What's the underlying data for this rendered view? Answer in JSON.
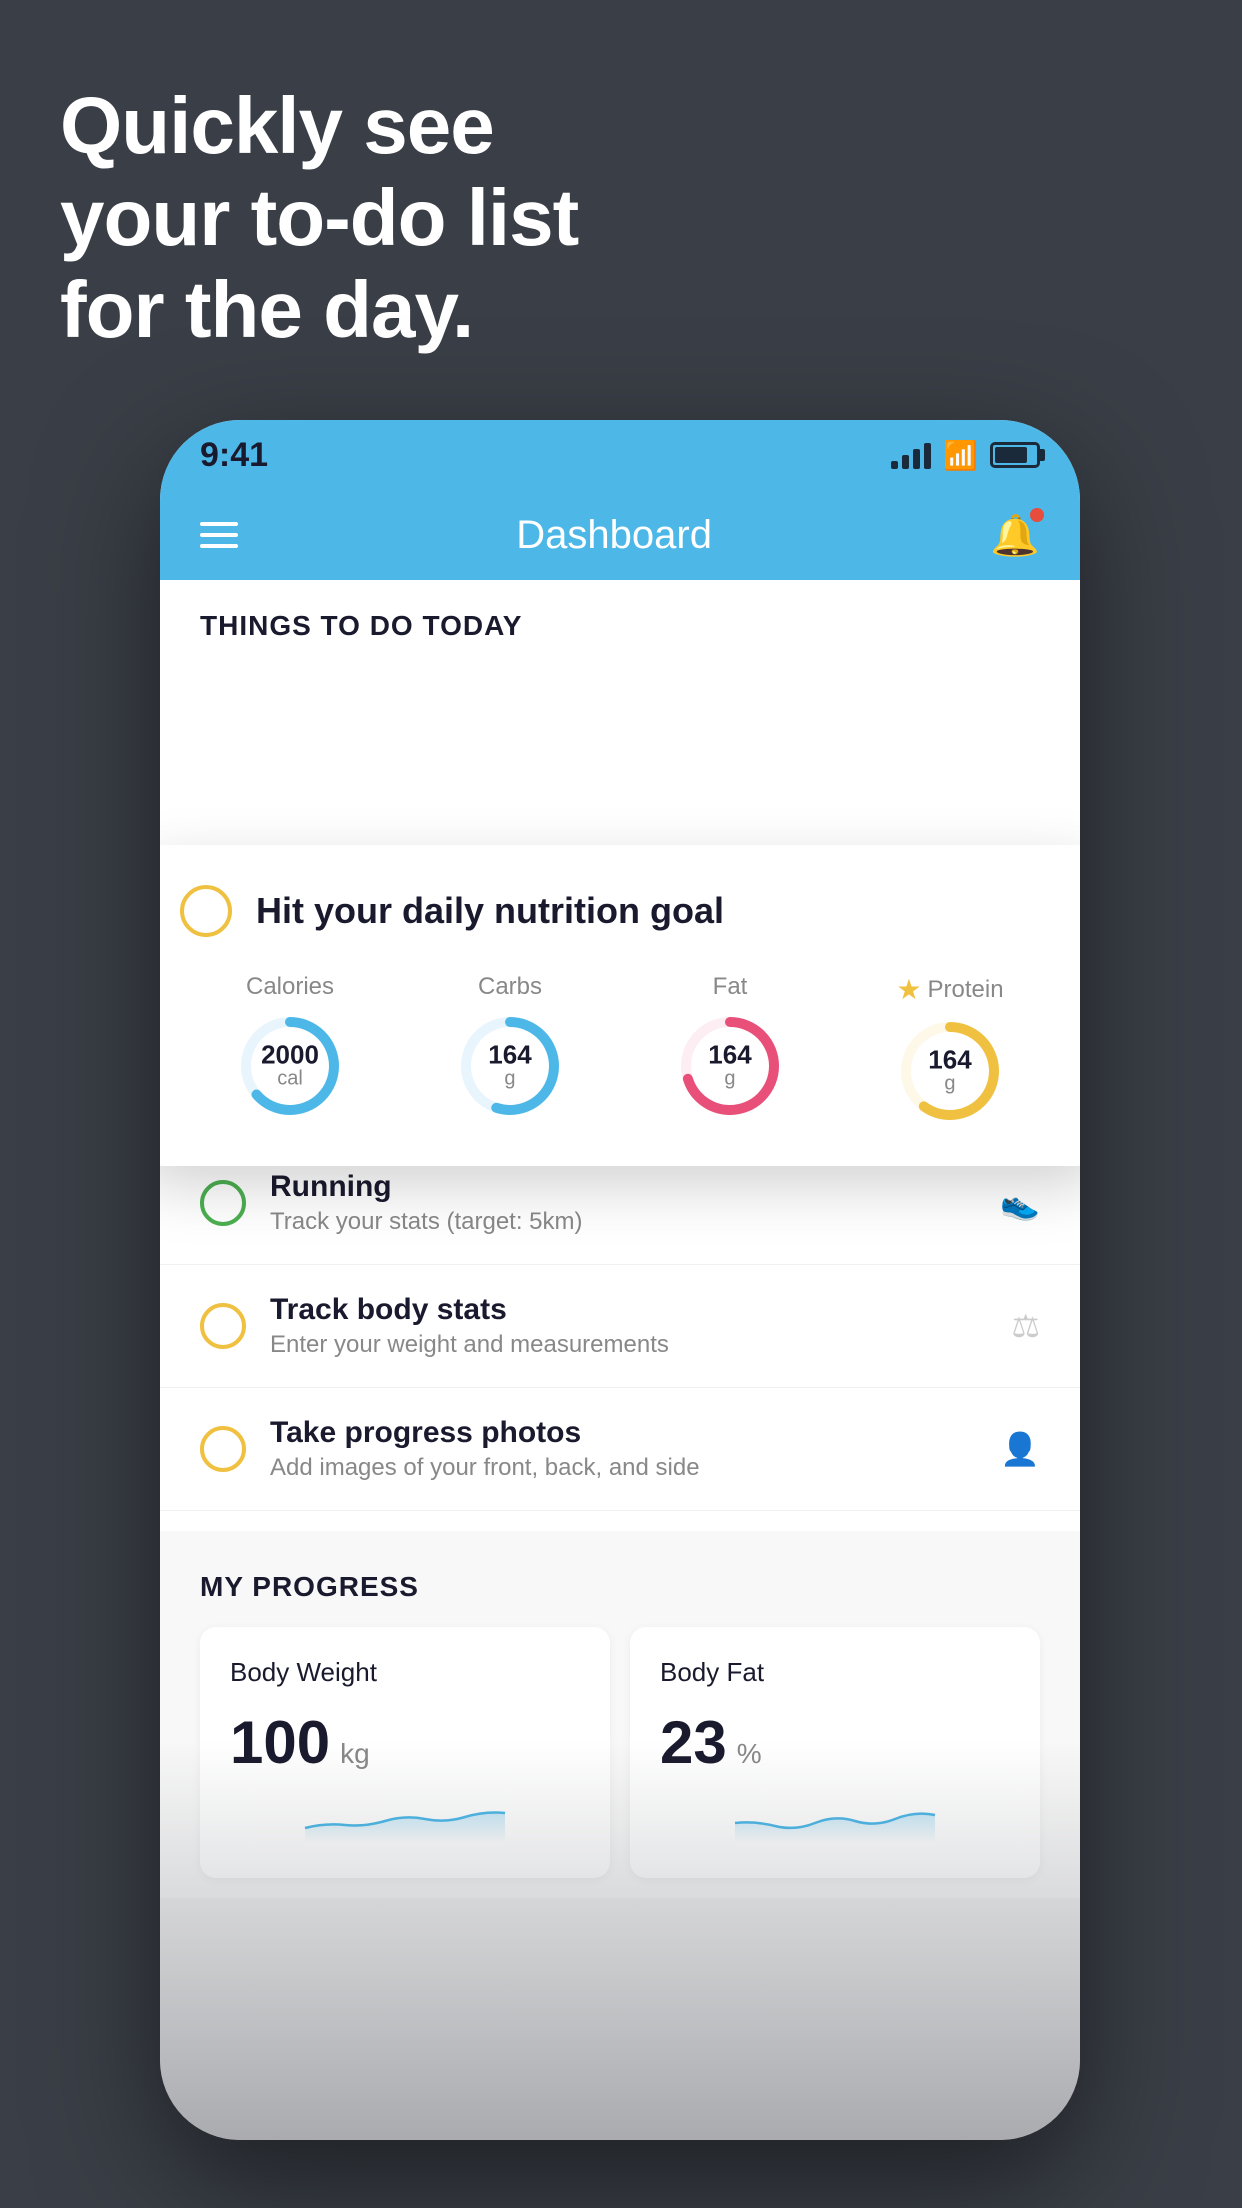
{
  "headline": {
    "line1": "Quickly see",
    "line2": "your to-do list",
    "line3": "for the day."
  },
  "phone": {
    "status_bar": {
      "time": "9:41"
    },
    "header": {
      "title": "Dashboard"
    },
    "things_section": {
      "title": "THINGS TO DO TODAY"
    },
    "floating_card": {
      "title": "Hit your daily nutrition goal",
      "nutrition": [
        {
          "label": "Calories",
          "value": "2000",
          "unit": "cal",
          "color": "#4db8e8",
          "track_color": "#e8f5fd",
          "progress": 0.65,
          "has_star": false
        },
        {
          "label": "Carbs",
          "value": "164",
          "unit": "g",
          "color": "#4db8e8",
          "track_color": "#e8f5fd",
          "progress": 0.55,
          "has_star": false
        },
        {
          "label": "Fat",
          "value": "164",
          "unit": "g",
          "color": "#e8507a",
          "track_color": "#fdeef3",
          "progress": 0.7,
          "has_star": false
        },
        {
          "label": "Protein",
          "value": "164",
          "unit": "g",
          "color": "#f0c040",
          "track_color": "#fdf8e8",
          "progress": 0.6,
          "has_star": true
        }
      ]
    },
    "list_items": [
      {
        "title": "Running",
        "subtitle": "Track your stats (target: 5km)",
        "circle_color": "green",
        "icon": "👟"
      },
      {
        "title": "Track body stats",
        "subtitle": "Enter your weight and measurements",
        "circle_color": "yellow",
        "icon": "⚖"
      },
      {
        "title": "Take progress photos",
        "subtitle": "Add images of your front, back, and side",
        "circle_color": "yellow",
        "icon": "👤"
      }
    ],
    "progress_section": {
      "title": "MY PROGRESS",
      "cards": [
        {
          "title": "Body Weight",
          "value": "100",
          "unit": "kg"
        },
        {
          "title": "Body Fat",
          "value": "23",
          "unit": "%"
        }
      ]
    }
  }
}
